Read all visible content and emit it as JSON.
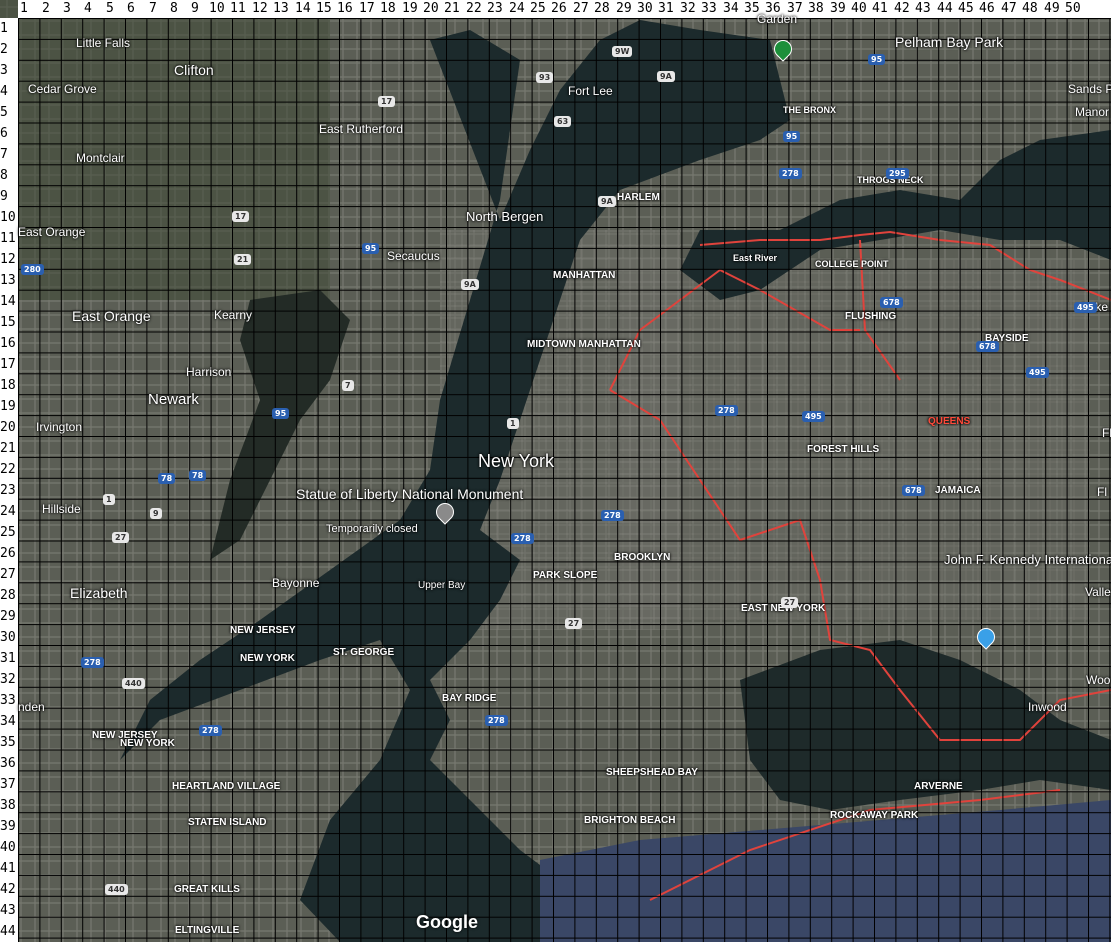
{
  "map": {
    "title": "New York",
    "provider": "Google",
    "grid": {
      "columns": [
        "1",
        "2",
        "3",
        "4",
        "5",
        "6",
        "7",
        "8",
        "9",
        "10",
        "11",
        "12",
        "13",
        "14",
        "15",
        "16",
        "17",
        "18",
        "19",
        "20",
        "21",
        "22",
        "23",
        "24",
        "25",
        "26",
        "27",
        "28",
        "29",
        "30",
        "31",
        "32",
        "33",
        "34",
        "35",
        "36",
        "37",
        "38",
        "39",
        "40",
        "41",
        "42",
        "43",
        "44",
        "45",
        "46",
        "47",
        "48",
        "49",
        "50"
      ],
      "rows": [
        "1",
        "2",
        "3",
        "4",
        "5",
        "6",
        "7",
        "8",
        "9",
        "10",
        "11",
        "12",
        "13",
        "14",
        "15",
        "16",
        "17",
        "18",
        "19",
        "20",
        "21",
        "22",
        "23",
        "24",
        "25",
        "26",
        "27",
        "28",
        "29",
        "30",
        "31",
        "32",
        "33",
        "34",
        "35",
        "36",
        "37",
        "38",
        "39",
        "40",
        "41",
        "42",
        "43",
        "44"
      ]
    },
    "places": [
      {
        "name": "Little Falls"
      },
      {
        "name": "Clifton"
      },
      {
        "name": "Cedar Grove"
      },
      {
        "name": "Montclair"
      },
      {
        "name": "East Rutherford"
      },
      {
        "name": "Fort Lee"
      },
      {
        "name": "Garden"
      },
      {
        "name": "Pelham Bay Park"
      },
      {
        "name": "Sands P"
      },
      {
        "name": "Manor"
      },
      {
        "name": "THE BRONX"
      },
      {
        "name": "HARLEM"
      },
      {
        "name": "THROGS NECK"
      },
      {
        "name": "North Bergen"
      },
      {
        "name": "East Orange"
      },
      {
        "name": "Secaucus"
      },
      {
        "name": "MANHATTAN"
      },
      {
        "name": "East River"
      },
      {
        "name": "COLLEGE POINT"
      },
      {
        "name": "East Orange"
      },
      {
        "name": "Kearny"
      },
      {
        "name": "FLUSHING"
      },
      {
        "name": "Lake"
      },
      {
        "name": "MIDTOWN MANHATTAN"
      },
      {
        "name": "BAYSIDE"
      },
      {
        "name": "Harrison"
      },
      {
        "name": "Newark"
      },
      {
        "name": "QUEENS"
      },
      {
        "name": "Irvington"
      },
      {
        "name": "FOREST HILLS"
      },
      {
        "name": "New York"
      },
      {
        "name": "Fl"
      },
      {
        "name": "JAMAICA"
      },
      {
        "name": "Fl"
      },
      {
        "name": "Hillside"
      },
      {
        "name": "Statue of Liberty National Monument"
      },
      {
        "name": "Temporarily closed"
      },
      {
        "name": "BROOKLYN"
      },
      {
        "name": "PARK SLOPE"
      },
      {
        "name": "John F. Kennedy International Airport"
      },
      {
        "name": "Bayonne"
      },
      {
        "name": "Elizabeth"
      },
      {
        "name": "Valle"
      },
      {
        "name": "EAST NEW YORK"
      },
      {
        "name": "NEW JERSEY"
      },
      {
        "name": "NEW YORK"
      },
      {
        "name": "ST. GEORGE"
      },
      {
        "name": "Upper Bay"
      },
      {
        "name": "BAY RIDGE"
      },
      {
        "name": "Woo"
      },
      {
        "name": "nden"
      },
      {
        "name": "Inwood"
      },
      {
        "name": "NEW JERSEY"
      },
      {
        "name": "NEW YORK"
      },
      {
        "name": "SHEEPSHEAD BAY"
      },
      {
        "name": "HEARTLAND VILLAGE"
      },
      {
        "name": "ARVERNE"
      },
      {
        "name": "STATEN ISLAND"
      },
      {
        "name": "BRIGHTON BEACH"
      },
      {
        "name": "ROCKAWAY PARK"
      },
      {
        "name": "GREAT KILLS"
      },
      {
        "name": "ELTINGVILLE"
      }
    ],
    "shields": [
      "9W",
      "95",
      "93",
      "9A",
      "63",
      "17",
      "95",
      "295",
      "278",
      "9A",
      "17",
      "280",
      "21",
      "95",
      "495",
      "9A",
      "678",
      "678",
      "495",
      "278",
      "495",
      "95",
      "7",
      "678",
      "1",
      "278",
      "78",
      "78",
      "278",
      "9",
      "1",
      "27",
      "440",
      "278",
      "278",
      "27",
      "278",
      "27",
      "440"
    ]
  }
}
